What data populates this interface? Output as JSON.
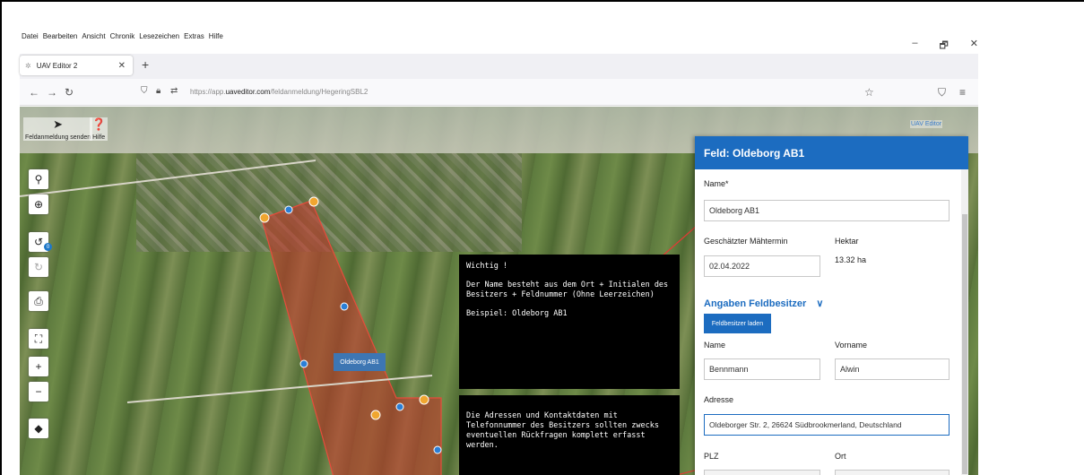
{
  "menu": [
    "Datei",
    "Bearbeiten",
    "Ansicht",
    "Chronik",
    "Lesezeichen",
    "Extras",
    "Hilfe"
  ],
  "window_controls": [
    "–",
    "🗗",
    "✕"
  ],
  "tab": {
    "title": "UAV Editor 2",
    "close": "✕",
    "new": "+"
  },
  "nav": {
    "back": "←",
    "forward": "→",
    "reload": "↻",
    "url_prefix": "https://app.",
    "url_domain": "uaveditor.com",
    "url_path": "/feldanmeldung/HegeringSBL2",
    "star": "☆",
    "shield": "⛉",
    "menu": "≡"
  },
  "apptools": [
    {
      "icon": "send-icon",
      "glyph": "➤",
      "label": "Feldanmeldung senden"
    },
    {
      "icon": "help-icon",
      "glyph": "❓",
      "label": "Hilfe"
    }
  ],
  "logo": {
    "text": "UAV Editor"
  },
  "map": {
    "controls": [
      "⚲",
      "⊕",
      "↺",
      "↻",
      "⎙",
      "⛶",
      "+",
      "−",
      "◆"
    ],
    "undo_badge": "0",
    "field_label": "Oldeborg AB1"
  },
  "infobox1": {
    "title": "Wichtig !",
    "text": "Der Name besteht aus dem Ort + Initialen des Besitzers + Feldnummer (Ohne Leerzeichen)",
    "example": "Beispiel: Oldeborg AB1"
  },
  "infobox2": {
    "text": "Die Adressen und Kontaktdaten mit Telefonnummer des Besitzers sollten zwecks eventuellen Rückfragen komplett erfasst werden."
  },
  "panel": {
    "title": "Feld: Oldeborg AB1",
    "name_label": "Name*",
    "name_value": "Oldeborg AB1",
    "date_label": "Geschätzter Mähtermin",
    "date_value": "02.04.2022",
    "hectare_label": "Hektar",
    "hectare_value": "13.32 ha",
    "owner_section": "Angaben Feldbesitzer",
    "owner_toggle": "∨",
    "load_owner": "Feldbesitzer laden",
    "lastname_label": "Name",
    "lastname_value": "Bennmann",
    "firstname_label": "Vorname",
    "firstname_value": "Alwin",
    "address_label": "Adresse",
    "address_value": "Oldeborger Str. 2, 26624 Südbrookmerland, Deutschland",
    "zip_label": "PLZ",
    "city_label": "Ort"
  },
  "colors": {
    "accent": "#1c6cc0",
    "field_fill": "#c0392b",
    "marker_orange": "#f0a630",
    "marker_blue": "#2b7fd6"
  }
}
